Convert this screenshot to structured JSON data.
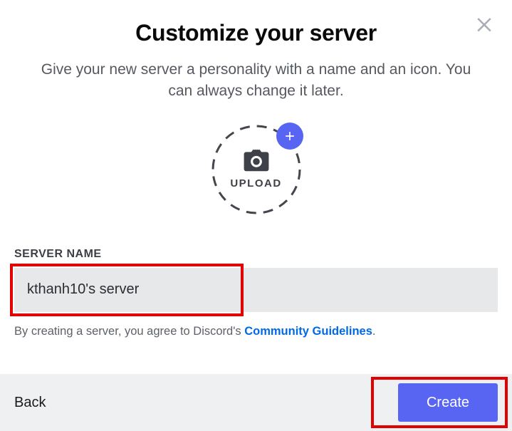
{
  "title": "Customize your server",
  "subtitle": "Give your new server a personality with a name and an icon. You can always change it later.",
  "upload": {
    "label": "UPLOAD"
  },
  "field": {
    "label": "SERVER NAME",
    "value": "kthanh10's server"
  },
  "guidelines": {
    "prefix": "By creating a server, you agree to Discord's ",
    "link_text": "Community Guidelines",
    "suffix": "."
  },
  "footer": {
    "back": "Back",
    "create": "Create"
  }
}
